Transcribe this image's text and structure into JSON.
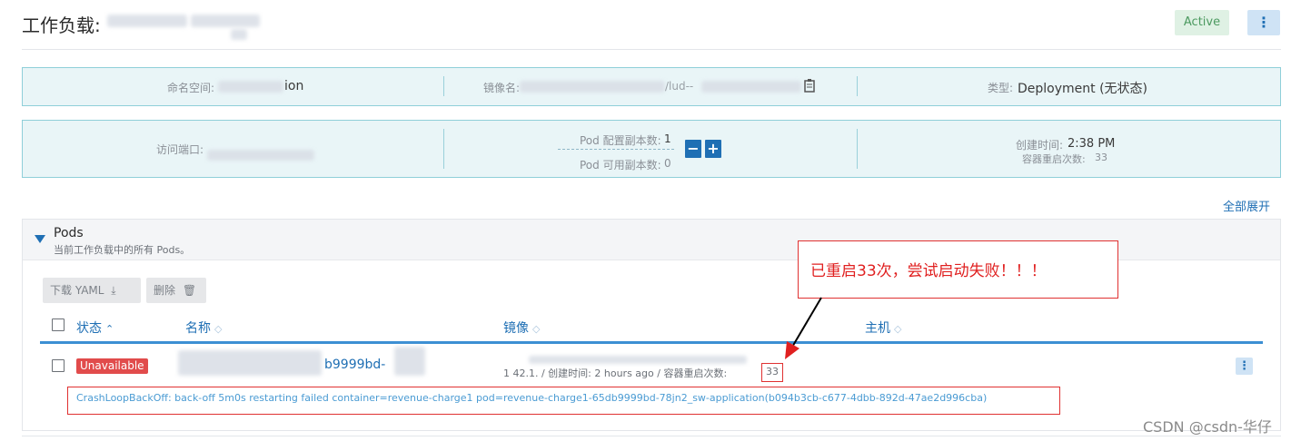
{
  "header": {
    "title": "工作负载:",
    "status_badge": "Active",
    "more_icon": "vertical-ellipsis-icon"
  },
  "info_row1": {
    "namespace_label": "命名空间:",
    "namespace_value_tail": "ion",
    "image_label": "镜像名:",
    "image_value_partial": "/lud--",
    "copy_icon": "clipboard-icon",
    "type_label": "类型:",
    "type_value": "Deployment (无状态)"
  },
  "info_row2": {
    "port_label": "访问端口:",
    "replicas_config_label": "Pod 配置副本数:",
    "replicas_config_value": "1",
    "replicas_available_label": "Pod 可用副本数:",
    "replicas_available_value": "0",
    "decrement": "−",
    "increment": "+",
    "created_label": "创建时间:",
    "created_value": "2:38 PM",
    "restarts_label": "容器重启次数:",
    "restarts_value": "33"
  },
  "expand_all": "全部展开",
  "pods": {
    "title": "Pods",
    "subtitle": "当前工作负载中的所有 Pods。",
    "download_yaml": "下载 YAML",
    "download_icon": "download-icon",
    "delete": "删除",
    "delete_icon": "trash-icon",
    "columns": [
      "状态",
      "名称",
      "镜像",
      "主机"
    ],
    "row": {
      "status": "Unavailable",
      "name_suffix": "b9999bd-",
      "image_meta": "1 42.1. / 创建时间: 2 hours ago / 容器重启次数:",
      "restarts": "33",
      "error": "CrashLoopBackOff: back-off 5m0s restarting failed container=revenue-charge1 pod=revenue-charge1-65db9999bd-78jn2_sw-application(b094b3cb-c677-4dbb-892d-47ae2d996cba)"
    }
  },
  "annotation": {
    "callout_text": "已重启33次，尝试启动失败！！！"
  },
  "watermark": "CSDN @csdn-华仔",
  "colors": {
    "accent": "#1f6fb4",
    "info_bg": "#e9f5f7",
    "danger": "#e14b4b",
    "annotation_red": "#e02020"
  }
}
